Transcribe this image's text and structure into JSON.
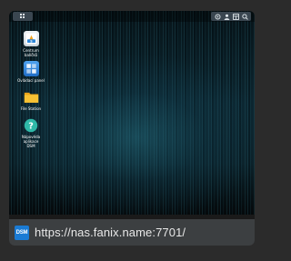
{
  "desktop": {
    "icons": [
      {
        "name": "package-center-icon",
        "label": "Centrum\nbalíčků"
      },
      {
        "name": "control-panel-icon",
        "label": "Ovládací panel"
      },
      {
        "name": "file-station-icon",
        "label": "File Station"
      },
      {
        "name": "dsm-help-icon",
        "label": "Nápověda aplikace\nDSM"
      }
    ]
  },
  "tray": {
    "icons": [
      "notifications-icon",
      "user-icon",
      "widgets-icon",
      "search-icon"
    ]
  },
  "url_bar": {
    "badge": "DSM",
    "url": "https://nas.fanix.name:7701/"
  },
  "colors": {
    "page_bg": "#2b2b2b",
    "url_bar_bg": "#3c3f41",
    "dsm_badge": "#1a7bd4"
  }
}
